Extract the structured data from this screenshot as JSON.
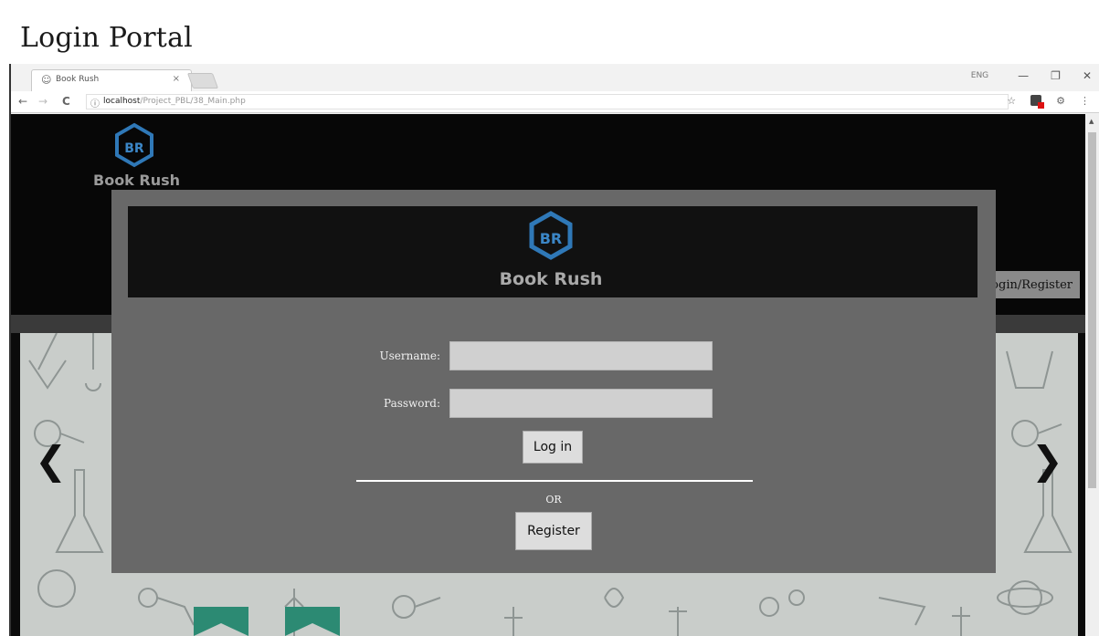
{
  "page": {
    "title": "Login Portal"
  },
  "browser": {
    "tab": {
      "title": "Book Rush",
      "close": "×"
    },
    "window_lang": "ENG",
    "window_controls": {
      "minimize": "—",
      "restore": "❐",
      "close": "✕"
    },
    "nav": {
      "back": "←",
      "forward": "→",
      "reload": "C"
    },
    "url": {
      "host": "localhost",
      "path": "/Project_PBL/38_Main.php"
    },
    "tool_icons": {
      "star": "☆",
      "settings": "⚙",
      "menu": "⋮"
    }
  },
  "site": {
    "brand": "Book Rush",
    "logo_letters": "BR",
    "header_button": "Login/Register",
    "carousel": {
      "prev": "❮",
      "next": "❯"
    }
  },
  "modal": {
    "brand": "Book Rush",
    "logo_letters": "BR",
    "username_label": "Username:",
    "username_value": "",
    "password_label": "Password:",
    "password_value": "",
    "login_label": "Log in",
    "or_text": "OR",
    "register_label": "Register"
  },
  "colors": {
    "overlay": "#686868",
    "banner": "#111111",
    "logo_blue": "#2f78b7",
    "input_bg": "#d0d0d0"
  }
}
